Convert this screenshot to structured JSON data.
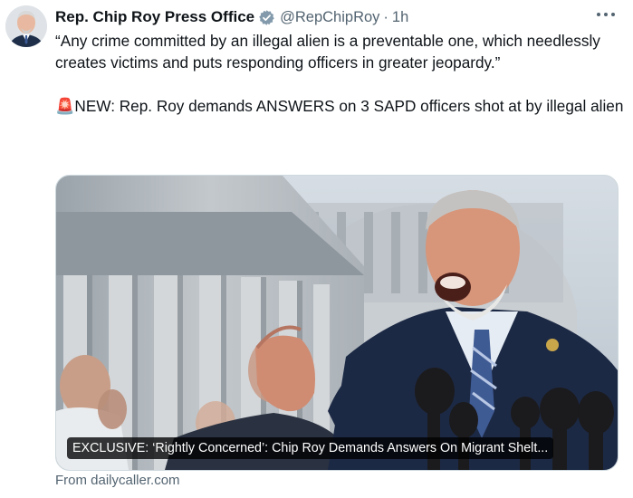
{
  "tweet": {
    "author_name": "Rep. Chip Roy Press Office",
    "handle": "@RepChipRoy",
    "separator": "·",
    "time": "1h",
    "verified_color": "#829aab",
    "text_line1": "“Any crime committed by an illegal alien is a preventable one, which needlessly creates victims and puts responding officers in greater jeopardy.”",
    "text_line2_emoji": "🚨",
    "text_line2": "NEW: Rep. Roy demands ANSWERS on 3 SAPD officers shot at by illegal alien"
  },
  "card": {
    "headline": "EXCLUSIVE: ‘Rightly Concerned’: Chip Roy Demands Answers On Migrant Shelt...",
    "source": "From dailycaller.com"
  },
  "icons": {
    "verified": "verified-badge-icon",
    "more": "more-horizontal-icon",
    "siren": "police-light-emoji"
  }
}
